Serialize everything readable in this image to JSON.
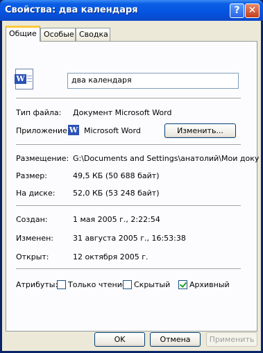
{
  "window": {
    "title": "Свойства: два календаря",
    "help_label": "?",
    "close_label": "✕"
  },
  "tabs": [
    {
      "label": "Общие"
    },
    {
      "label": "Особые"
    },
    {
      "label": "Сводка"
    }
  ],
  "general": {
    "file_icon": "word-document-icon",
    "name": "два календаря",
    "file_type_label": "Тип файла:",
    "file_type_value": "Документ Microsoft Word",
    "app_label": "Приложение:",
    "app_icon": "word-icon",
    "app_value": "Microsoft Word",
    "change_button": "Изменить...",
    "location_label": "Размещение:",
    "location_value": "G:\\Documents and Settings\\анатолий\\Мои доку",
    "size_label": "Размер:",
    "size_value": "49,5 КБ (50 688 байт)",
    "disk_label": "На диске:",
    "disk_value": "52,0 КБ (53 248 байт)",
    "created_label": "Создан:",
    "created_value": "1 мая 2005 г., 2:22:54",
    "modified_label": "Изменен:",
    "modified_value": "31 августа 2005 г., 16:53:38",
    "opened_label": "Открыт:",
    "opened_value": "12 октября 2005 г.",
    "attributes_label": "Атрибуты:",
    "attributes": [
      {
        "label": "Только чтение",
        "checked": false
      },
      {
        "label": "Скрытый",
        "checked": false
      },
      {
        "label": "Архивный",
        "checked": true
      }
    ]
  },
  "buttons": {
    "ok": "OK",
    "cancel": "Отмена",
    "apply": "Применить"
  }
}
